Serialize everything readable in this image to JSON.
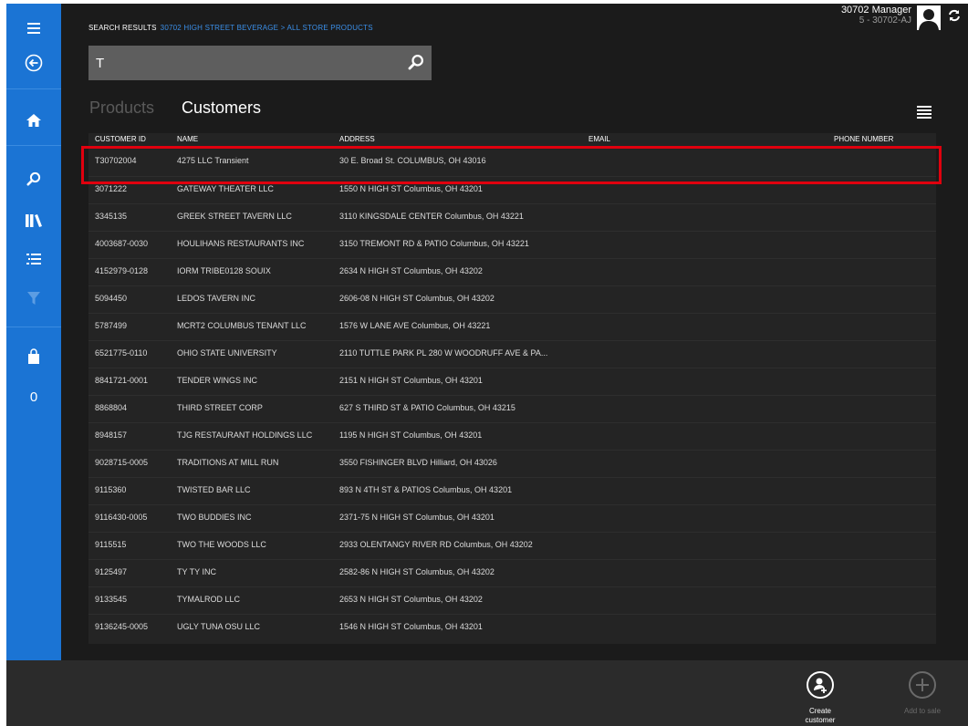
{
  "breadcrumb": {
    "label": "SEARCH RESULTS",
    "path": "30702 HIGH STREET BEVERAGE > ALL STORE PRODUCTS"
  },
  "user": {
    "name": "30702 Manager",
    "sub": "5 - 30702-AJ"
  },
  "search": {
    "value": "T"
  },
  "tabs": {
    "products": "Products",
    "customers": "Customers"
  },
  "sidebar": {
    "cart_count": "0",
    "icons": [
      "menu-icon",
      "back-icon",
      "home-icon",
      "search-icon",
      "library-icon",
      "list-icon",
      "filter-icon",
      "shopping-bag-icon"
    ]
  },
  "table": {
    "headers": {
      "id": "CUSTOMER ID",
      "name": "NAME",
      "address": "ADDRESS",
      "email": "EMAIL",
      "phone": "PHONE NUMBER"
    },
    "rows": [
      {
        "id": "T30702004",
        "name": "4275 LLC Transient",
        "address": "30 E. Broad St. COLUMBUS, OH 43016",
        "email": "",
        "phone": ""
      },
      {
        "id": "3071222",
        "name": "GATEWAY THEATER LLC",
        "address": "1550 N HIGH ST Columbus, OH 43201",
        "email": "",
        "phone": ""
      },
      {
        "id": "3345135",
        "name": "GREEK STREET TAVERN LLC",
        "address": "3110 KINGSDALE CENTER Columbus, OH 43221",
        "email": "",
        "phone": ""
      },
      {
        "id": "4003687-0030",
        "name": "HOULIHANS RESTAURANTS INC",
        "address": "3150 TREMONT RD & PATIO Columbus, OH 43221",
        "email": "",
        "phone": ""
      },
      {
        "id": "4152979-0128",
        "name": "IORM TRIBE0128 SOUIX",
        "address": "2634 N HIGH ST Columbus, OH 43202",
        "email": "",
        "phone": ""
      },
      {
        "id": "5094450",
        "name": "LEDOS TAVERN INC",
        "address": "2606-08 N HIGH ST Columbus, OH 43202",
        "email": "",
        "phone": ""
      },
      {
        "id": "5787499",
        "name": "MCRT2 COLUMBUS TENANT LLC",
        "address": "1576 W LANE AVE Columbus, OH 43221",
        "email": "",
        "phone": ""
      },
      {
        "id": "6521775-0110",
        "name": "OHIO STATE UNIVERSITY",
        "address": "2110 TUTTLE PARK PL 280 W WOODRUFF AVE & PA...",
        "email": "",
        "phone": ""
      },
      {
        "id": "8841721-0001",
        "name": "TENDER WINGS INC",
        "address": "2151 N HIGH ST Columbus, OH 43201",
        "email": "",
        "phone": ""
      },
      {
        "id": "8868804",
        "name": "THIRD STREET CORP",
        "address": "627 S THIRD ST & PATIO Columbus, OH 43215",
        "email": "",
        "phone": ""
      },
      {
        "id": "8948157",
        "name": "TJG RESTAURANT HOLDINGS LLC",
        "address": "1195 N HIGH ST Columbus, OH 43201",
        "email": "",
        "phone": ""
      },
      {
        "id": "9028715-0005",
        "name": "TRADITIONS AT MILL RUN",
        "address": "3550 FISHINGER BLVD Hilliard, OH 43026",
        "email": "",
        "phone": ""
      },
      {
        "id": "9115360",
        "name": "TWISTED BAR LLC",
        "address": "893 N 4TH ST & PATIOS Columbus, OH 43201",
        "email": "",
        "phone": ""
      },
      {
        "id": "9116430-0005",
        "name": "TWO BUDDIES INC",
        "address": "2371-75 N HIGH ST Columbus, OH 43201",
        "email": "",
        "phone": ""
      },
      {
        "id": "9115515",
        "name": "TWO THE WOODS LLC",
        "address": "2933 OLENTANGY RIVER RD Columbus, OH 43202",
        "email": "",
        "phone": ""
      },
      {
        "id": "9125497",
        "name": "TY TY INC",
        "address": "2582-86 N HIGH ST Columbus, OH 43202",
        "email": "",
        "phone": ""
      },
      {
        "id": "9133545",
        "name": "TYMALROD LLC",
        "address": "2653 N HIGH ST Columbus, OH 43202",
        "email": "",
        "phone": ""
      },
      {
        "id": "9136245-0005",
        "name": "UGLY TUNA OSU LLC",
        "address": "1546 N HIGH ST Columbus, OH 43201",
        "email": "",
        "phone": ""
      }
    ]
  },
  "bottom": {
    "create_l1": "Create",
    "create_l2": "customer",
    "add_label": "Add to sale"
  },
  "colors": {
    "sidebar": "#1b74d4",
    "background": "#1b1b1b",
    "table": "#242424",
    "highlight": "#e0000e",
    "link": "#3b8fe8"
  }
}
